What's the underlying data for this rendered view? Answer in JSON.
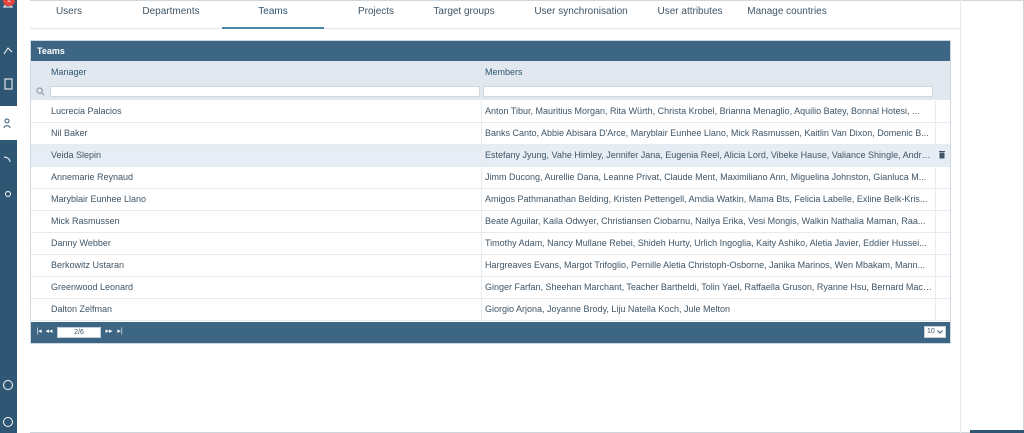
{
  "nav": {
    "notification_count": "1",
    "icons": [
      "bell-icon",
      "share-icon",
      "document-icon",
      "users-icon",
      "feed-icon",
      "settings-icon",
      "info-icon",
      "help-icon"
    ]
  },
  "tabs": [
    {
      "label": "Users",
      "active": false
    },
    {
      "label": "Departments",
      "active": false
    },
    {
      "label": "Teams",
      "active": true
    },
    {
      "label": "Projects",
      "active": false
    },
    {
      "label": "Target groups",
      "active": false
    },
    {
      "label": "User synchronisation",
      "active": false
    },
    {
      "label": "User attributes",
      "active": false
    },
    {
      "label": "Manage countries",
      "active": false
    }
  ],
  "panel": {
    "title": "Teams",
    "columns": {
      "manager": "Manager",
      "members": "Members"
    },
    "filters": {
      "manager": "",
      "members": ""
    },
    "rows": [
      {
        "manager": "Lucrecia Palacios",
        "members": "Anton Tibur, Mauritius Morgan, Rita Würth, Christa Krobel, Brianna Menaglio, Aquilio Batey, Bonnal Hotesi, ..."
      },
      {
        "manager": "Nil Baker",
        "members": "Banks Canto, Abbie Abisara D'Arce, Maryblair Eunhee Llano, Mick Rasmussen, Kaitlin Van Dixon, Domenic B..."
      },
      {
        "manager": "Veida Slepin",
        "members": "Estefany Jyung, Vahe Himley, Jennifer Jana, Eugenia Reel, Alicia Lord, Vibeke Hause, Valiance Shingle, Andra ...",
        "selected": true
      },
      {
        "manager": "Annemarie Reynaud",
        "members": "Jimm Ducong, Aurellie Dana, Leanne Privat, Claude Ment, Maximiliano Ann, Miguelina Johnston, Gianluca M..."
      },
      {
        "manager": "Maryblair Eunhee Llano",
        "members": "Amigos Pathmanathan Belding, Kristen Pettengell, Amdia Watkin, Mama Bts, Felicia Labelle, Exline Belk-Kris..."
      },
      {
        "manager": "Mick Rasmussen",
        "members": "Beate Aguilar, Kaila Odwyer, Christiansen Ciobarnu, Nailya Erika, Vesi Mongis, Walkin Nathalia Maman, Raa..."
      },
      {
        "manager": "Danny Webber",
        "members": "Timothy Adam, Nancy Mullane Rebei, Shideh Hurty, Urlich Ingoglia, Kaity Ashiko, Aletia Javier, Eddier Hussei..."
      },
      {
        "manager": "Berkowitz Ustaran",
        "members": "Hargreaves Evans, Margot Trifoglio, Pernille Aletia Christoph-Osborne, Janika Marinos, Wen Mbakam, Mann..."
      },
      {
        "manager": "Greenwood Leonard",
        "members": "Ginger Farfan, Sheehan Marchant, Teacher Bartheldi, Tolin Yael, Raffaella Gruson, Ryanne Hsu, Bernard Macl..."
      },
      {
        "manager": "Dalton Zelfman",
        "members": "Giorgio Arjona, Joyanne Brody, Liju Natella Koch, Jule Melton"
      }
    ],
    "pager": {
      "page": "2/6",
      "page_size": "10"
    }
  },
  "colors": {
    "accent": "#3d6684",
    "nav": "#2f5673",
    "header_bg": "#e1e8ef",
    "selected_row": "#e6edf4",
    "badge": "#e0463b"
  }
}
